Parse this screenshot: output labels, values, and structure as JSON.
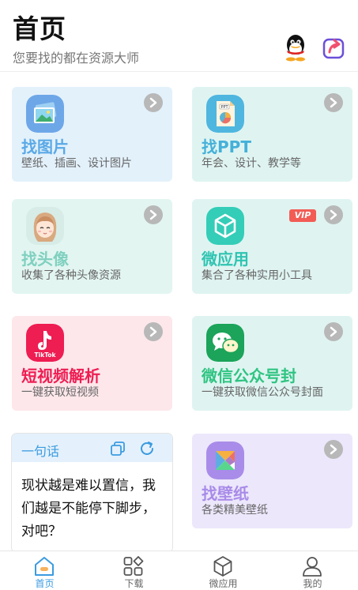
{
  "header": {
    "title": "首页",
    "subtitle": "您要找的都在资源大师"
  },
  "cards": [
    {
      "title": "找图片",
      "desc": "壁纸、插画、设计图片",
      "color": "#5aa9e6"
    },
    {
      "title": "找PPT",
      "desc": "年会、设计、教学等",
      "color": "#45b0d9",
      "icon_text": "PPT"
    },
    {
      "title": "找头像",
      "desc": "收集了各种头像资源",
      "color": "#7fd0bf"
    },
    {
      "title": "微应用",
      "desc": "集合了各种实用小工具",
      "color": "#2fc4b2",
      "badge": "VIP"
    },
    {
      "title": "短视频解析",
      "desc": "一键获取短视频",
      "color": "#ee1d52",
      "icon_text": "TikTok"
    },
    {
      "title": "微信公众号封",
      "desc": "一键获取微信公众号封面",
      "color": "#2fc482"
    },
    {
      "title": "找壁纸",
      "desc": "各类精美壁纸",
      "color": "#a88be8"
    }
  ],
  "quote": {
    "label": "一句话",
    "text": "现状越是难以置信，我们越是不能停下脚步，对吧？"
  },
  "tabbar": {
    "active_color": "#3b9be0",
    "items": [
      {
        "label": "首页",
        "icon": "home-icon",
        "active": true
      },
      {
        "label": "下载",
        "icon": "grid-icon"
      },
      {
        "label": "微应用",
        "icon": "cube-icon"
      },
      {
        "label": "我的",
        "icon": "user-icon"
      }
    ]
  }
}
